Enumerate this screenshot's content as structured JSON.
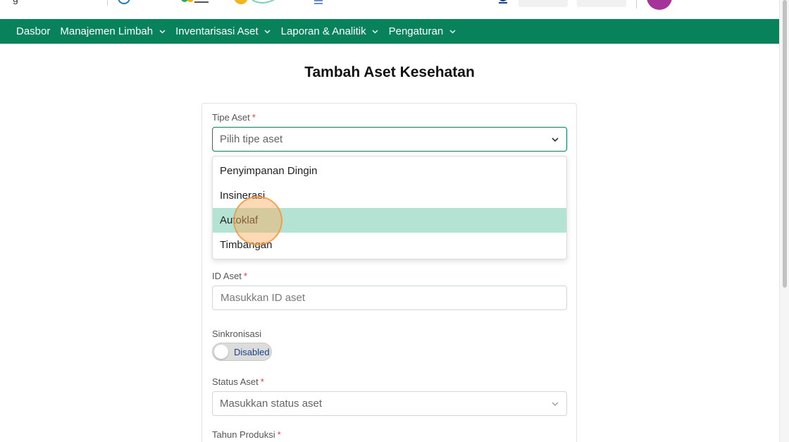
{
  "header": {
    "brand_cut": "g",
    "logos": [
      "logo-kemenkes-icon",
      "logo-indonesia-icon",
      "logo-partner-icon",
      "logo-menu-icon"
    ]
  },
  "nav": {
    "items": [
      {
        "label": "Dasbor",
        "has_menu": false
      },
      {
        "label": "Manajemen Limbah",
        "has_menu": true
      },
      {
        "label": "Inventarisasi Aset",
        "has_menu": true
      },
      {
        "label": "Laporan & Analitik",
        "has_menu": true
      },
      {
        "label": "Pengaturan",
        "has_menu": true
      }
    ],
    "color": "#08825a"
  },
  "page": {
    "title": "Tambah Aset Kesehatan"
  },
  "form": {
    "asset_type": {
      "label": "Tipe Aset",
      "required": "*",
      "placeholder": "Pilih tipe aset",
      "options": [
        "Penyimpanan Dingin",
        "Insinerasi",
        "Autoklaf",
        "Timbangan"
      ],
      "highlighted_option": "Autoklaf"
    },
    "asset_id": {
      "label": "ID Aset",
      "required": "*",
      "placeholder": "Masukkan ID aset"
    },
    "sync": {
      "label": "Sinkronisasi",
      "toggle_text": "Disabled",
      "enabled": false
    },
    "asset_status": {
      "label": "Status Aset",
      "required": "*",
      "placeholder": "Masukkan status aset"
    },
    "production_year": {
      "label": "Tahun Produksi",
      "required": "*"
    }
  },
  "colors": {
    "accent": "#08825a",
    "highlight": "#b4e3d4",
    "required": "#e0413f",
    "avatar": "#a5349a"
  }
}
